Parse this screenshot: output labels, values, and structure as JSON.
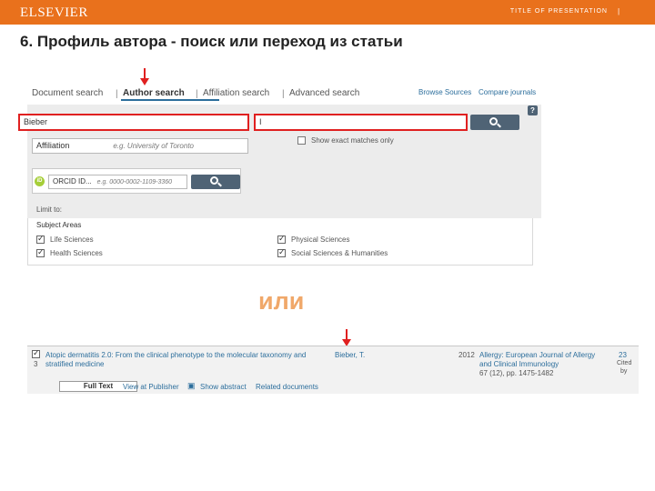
{
  "header": {
    "logo": "ELSEVIER",
    "presentation_title": "TITLE OF PRESENTATION",
    "separator": "|",
    "bar_color": "#e9711c"
  },
  "slide": {
    "title": "6. Профиль автора - поиск или переход из статьи",
    "or_text": "или"
  },
  "search": {
    "tabs": [
      "Document search",
      "Author search",
      "Affiliation search",
      "Advanced search"
    ],
    "active_tab": "Author search",
    "separators": [
      "|",
      "|",
      "|"
    ],
    "links": {
      "browse_sources": "Browse Sources",
      "compare_journals": "Compare journals"
    },
    "last_name_value": "Bieber",
    "first_name_value": "I",
    "help": "?",
    "exact_matches_label": "Show exact matches only",
    "affiliation_label": "Affiliation",
    "affiliation_hint": "e.g. University of Toronto",
    "orcid_label": "ORCID ID...",
    "orcid_hint": "e.g. 0000-0002-1109-3360",
    "orcid_badge": "iD",
    "limit_to": "Limit to:",
    "subject_areas_label": "Subject Areas",
    "subject_areas": [
      "Life Sciences",
      "Health Sciences",
      "Physical Sciences",
      "Social Sciences & Humanities"
    ],
    "highlight_color": "#e02020",
    "button_color": "#4f6375"
  },
  "result": {
    "index": "3",
    "title_line1": "Atopic dermatitis 2.0: From the clinical phenotype to the molecular taxonomy and",
    "title_line2": "stratified medicine",
    "author": "Bieber, T.",
    "year": "2012",
    "source_line1": "Allergy: European Journal of Allergy",
    "source_line2": "and Clinical Immunology",
    "source_line3": "67 (12), pp. 1475-1482",
    "cited_count": "23",
    "cited_line2": "Cited",
    "cited_line3": "by",
    "full_text": "Full Text",
    "view_publisher": "View at Publisher",
    "show_abstract": "Show abstract",
    "related_docs": "Related documents"
  }
}
